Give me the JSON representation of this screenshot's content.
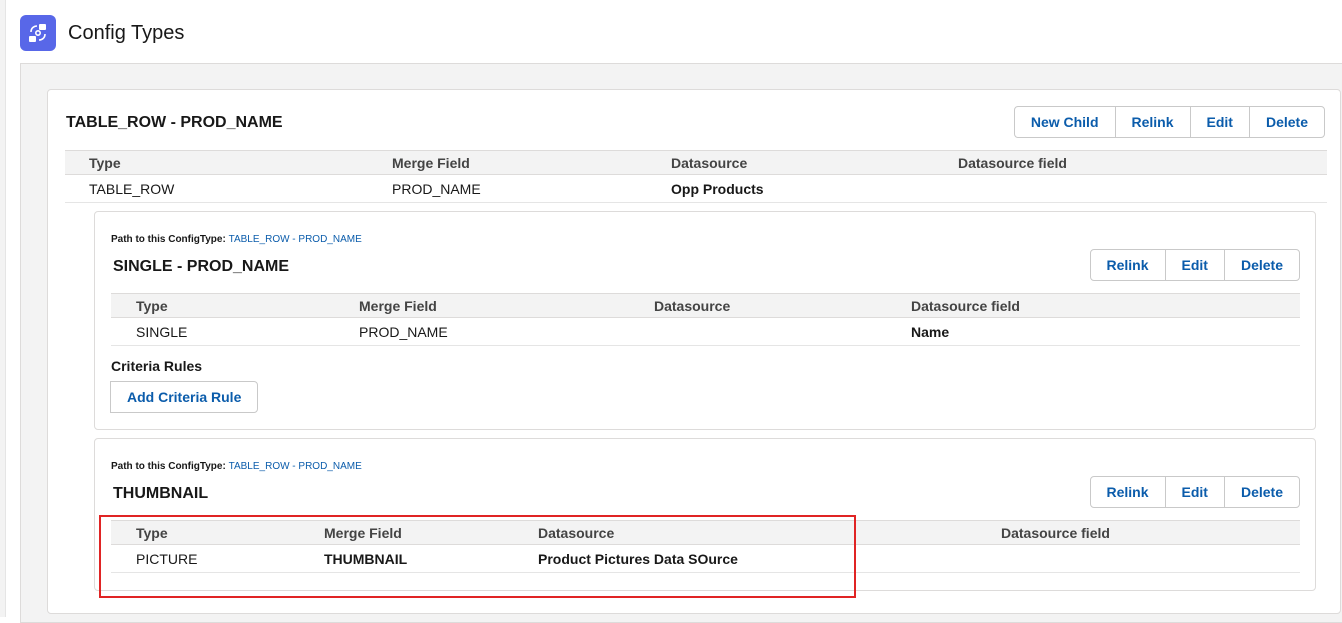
{
  "header": {
    "title": "Config Types",
    "icon": "config-flow-icon",
    "icon_color": "#5867e8"
  },
  "main_card": {
    "title": "TABLE_ROW - PROD_NAME",
    "buttons": [
      "New Child",
      "Relink",
      "Edit",
      "Delete"
    ],
    "columns": [
      "Type",
      "Merge Field",
      "Datasource",
      "Datasource field"
    ],
    "row": [
      "TABLE_ROW",
      "PROD_NAME",
      "Opp Products",
      ""
    ]
  },
  "children": [
    {
      "path_label": "Path to this ConfigType:",
      "path_link": "TABLE_ROW - PROD_NAME",
      "title": "SINGLE - PROD_NAME",
      "buttons": [
        "Relink",
        "Edit",
        "Delete"
      ],
      "columns": [
        "Type",
        "Merge Field",
        "Datasource",
        "Datasource field"
      ],
      "row": [
        "SINGLE",
        "PROD_NAME",
        "",
        "Name"
      ],
      "criteria_label": "Criteria Rules",
      "add_rule_label": "Add Criteria Rule"
    },
    {
      "path_label": "Path to this ConfigType:",
      "path_link": "TABLE_ROW - PROD_NAME",
      "title": "THUMBNAIL",
      "buttons": [
        "Relink",
        "Edit",
        "Delete"
      ],
      "columns": [
        "Type",
        "Merge Field",
        "Datasource",
        "Datasource field"
      ],
      "row": [
        "PICTURE",
        "THUMBNAIL",
        "Product Pictures Data SOurce",
        ""
      ]
    }
  ],
  "colors": {
    "link": "#0b5cab",
    "highlight_border": "#e02424",
    "panel_bg": "#f3f3f3"
  }
}
